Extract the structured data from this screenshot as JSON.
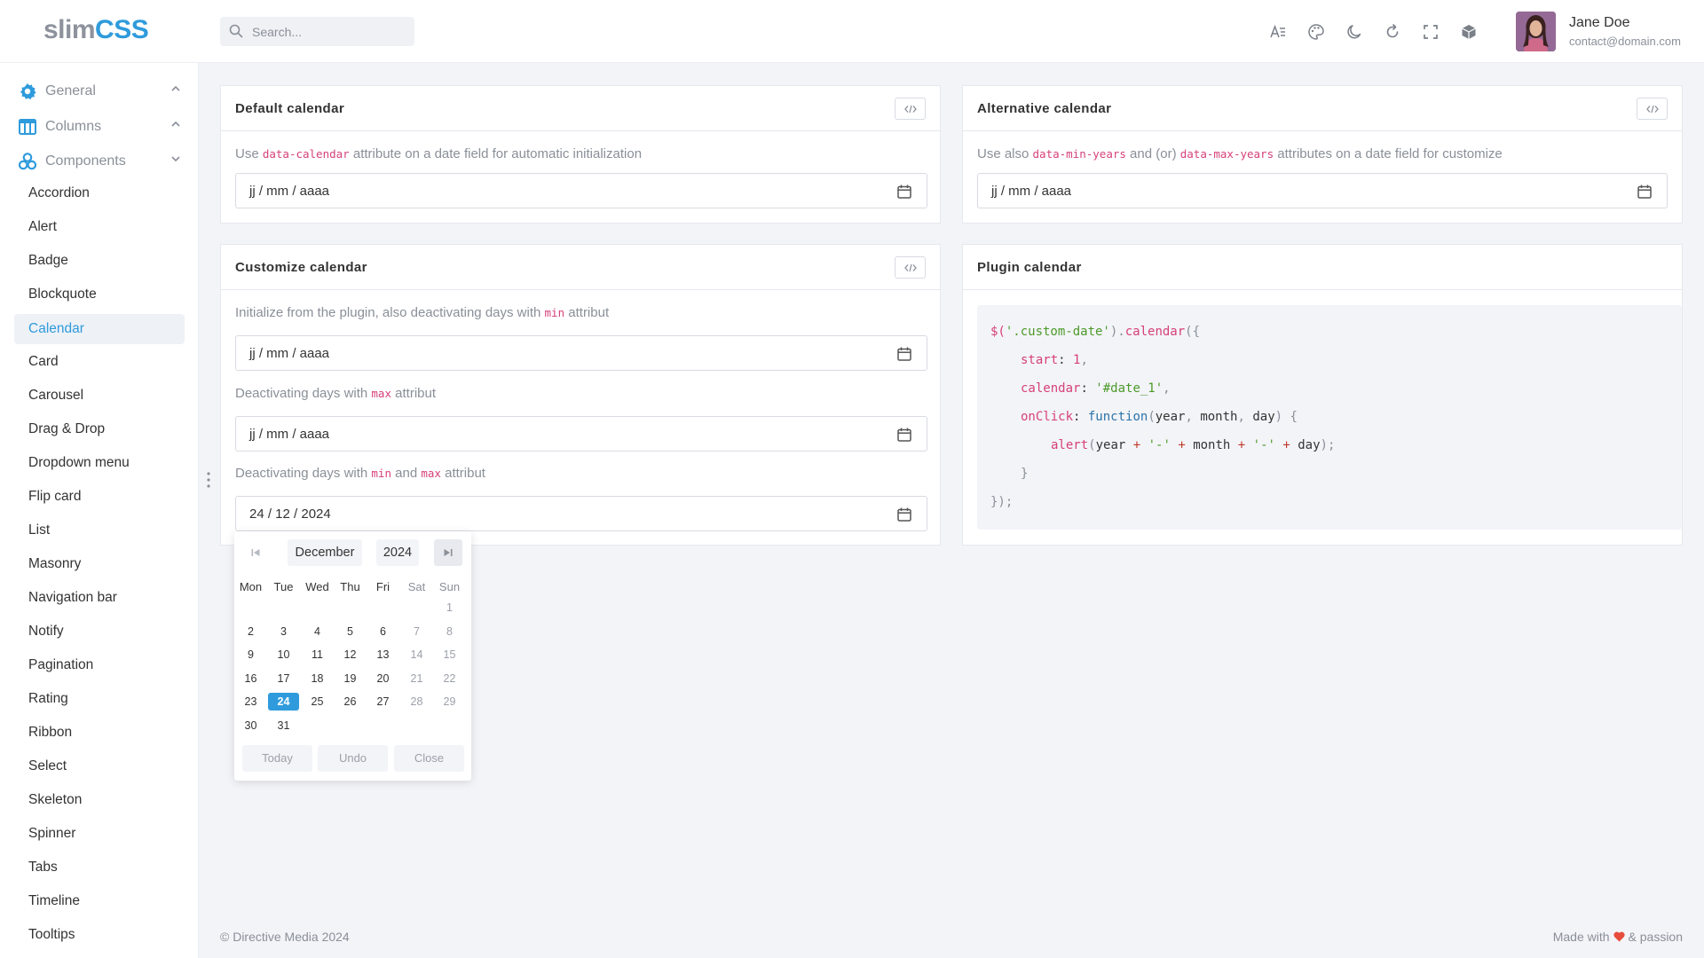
{
  "brand": {
    "part1": "slim",
    "part2": "CSS"
  },
  "search": {
    "placeholder": "Search..."
  },
  "toolbar": {
    "icons": [
      "text-size-icon",
      "palette-icon",
      "moon-icon",
      "refresh-icon",
      "fullscreen-icon",
      "package-icon"
    ]
  },
  "user": {
    "name": "Jane Doe",
    "email": "contact@domain.com"
  },
  "sidebar": {
    "sections": [
      {
        "label": "General",
        "icon": "gear-icon",
        "expanded": false
      },
      {
        "label": "Columns",
        "icon": "columns-icon",
        "expanded": false
      },
      {
        "label": "Components",
        "icon": "components-icon",
        "expanded": true
      }
    ],
    "items": [
      "Accordion",
      "Alert",
      "Badge",
      "Blockquote",
      "Calendar",
      "Card",
      "Carousel",
      "Drag & Drop",
      "Dropdown menu",
      "Flip card",
      "List",
      "Masonry",
      "Navigation bar",
      "Notify",
      "Pagination",
      "Rating",
      "Ribbon",
      "Select",
      "Skeleton",
      "Spinner",
      "Tabs",
      "Timeline",
      "Tooltips"
    ],
    "active": "Calendar"
  },
  "cards": {
    "default": {
      "title": "Default calendar",
      "desc_pre": "Use ",
      "desc_code": "data-calendar",
      "desc_post": " attribute on a date field for automatic initialization",
      "field_value": "jj / mm / aaaa"
    },
    "alternative": {
      "title": "Alternative calendar",
      "desc_pre": "Use also ",
      "desc_code1": "data-min-years",
      "desc_mid": " and (or) ",
      "desc_code2": "data-max-years",
      "desc_post": " attributes on a date field for customize",
      "field_value": "jj / mm / aaaa"
    },
    "customize": {
      "title": "Customize calendar",
      "desc1_pre": "Initialize from the plugin, also deactivating days with ",
      "desc1_code": "min",
      "desc1_post": " attribut",
      "field1_value": "jj / mm / aaaa",
      "desc2_pre": "Deactivating days with ",
      "desc2_code": "max",
      "desc2_post": " attribut",
      "field2_value": "jj / mm / aaaa",
      "desc3_pre": "Deactivating days with ",
      "desc3_code1": "min",
      "desc3_mid": " and ",
      "desc3_code2": "max",
      "desc3_post": " attribut",
      "field3_value": "24 / 12 / 2024"
    },
    "plugin": {
      "title": "Plugin calendar",
      "code": {
        "l1a": "$(",
        "l1b": "'.custom-date'",
        "l1c": ").",
        "l1d": "calendar",
        "l1e": "({",
        "l2a": "start",
        "l2b": ": ",
        "l2c": "1",
        "l2d": ",",
        "l3a": "calendar",
        "l3b": ": ",
        "l3c": "'#date_1'",
        "l3d": ",",
        "l4a": "onClick",
        "l4b": ": ",
        "l4c": "function",
        "l4d": "(",
        "l4e": "year",
        "l4f": ", ",
        "l4g": "month",
        "l4h": ", ",
        "l4i": "day",
        "l4j": ") {",
        "l5a": "alert",
        "l5b": "(",
        "l5c": "year",
        "l5d": " + ",
        "l5e": "'-'",
        "l5f": " + ",
        "l5g": "month",
        "l5h": " + ",
        "l5i": "'-'",
        "l5j": " + ",
        "l5k": "day",
        "l5l": ");",
        "l6": "}",
        "l7": "});"
      }
    }
  },
  "calendar_popup": {
    "month": "December",
    "year": "2024",
    "weekdays": [
      "Mon",
      "Tue",
      "Wed",
      "Thu",
      "Fri",
      "Sat",
      "Sun"
    ],
    "first_weekday_index": 6,
    "days_in_month": 31,
    "selected_day": 24,
    "buttons": {
      "today": "Today",
      "undo": "Undo",
      "close": "Close"
    }
  },
  "footer": {
    "copyright": "© Directive Media 2024",
    "made_with": "Made with",
    "passion": "& passion"
  },
  "colors": {
    "accent": "#2f9bdc",
    "code_pink": "#d6407a",
    "code_green": "#4c9a2a",
    "heart": "#e74c3c"
  }
}
